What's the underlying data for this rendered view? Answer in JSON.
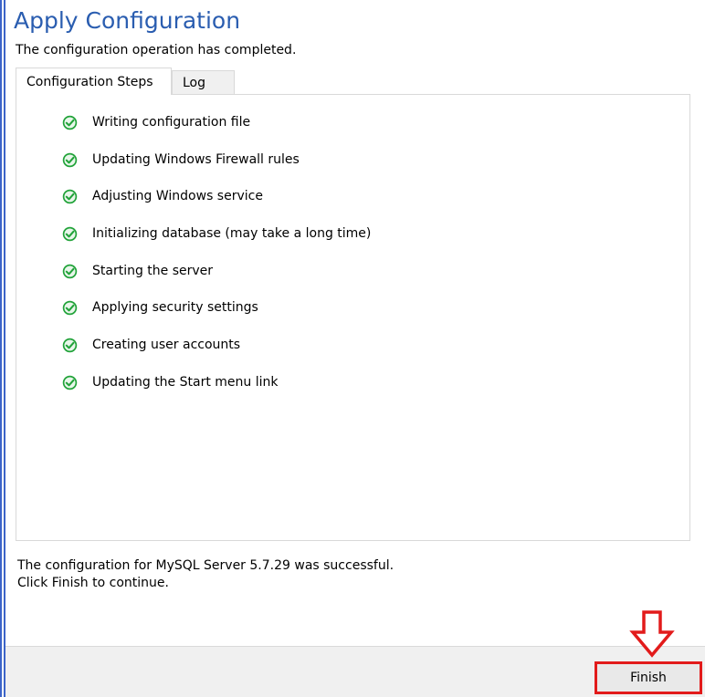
{
  "header": {
    "title": "Apply Configuration",
    "subtitle": "The configuration operation has completed."
  },
  "tabs": [
    {
      "label": "Configuration Steps",
      "active": true
    },
    {
      "label": "Log",
      "active": false
    }
  ],
  "steps": [
    {
      "label": "Writing configuration file",
      "status": "done"
    },
    {
      "label": "Updating Windows Firewall rules",
      "status": "done"
    },
    {
      "label": "Adjusting Windows service",
      "status": "done"
    },
    {
      "label": "Initializing database (may take a long time)",
      "status": "done"
    },
    {
      "label": "Starting the server",
      "status": "done"
    },
    {
      "label": "Applying security settings",
      "status": "done"
    },
    {
      "label": "Creating user accounts",
      "status": "done"
    },
    {
      "label": "Updating the Start menu link",
      "status": "done"
    }
  ],
  "result": {
    "line1": "The configuration for MySQL Server 5.7.29 was successful.",
    "line2": "Click Finish to continue."
  },
  "footer": {
    "finish_label": "Finish"
  },
  "colors": {
    "title": "#2a5db0",
    "check": "#22a33a",
    "highlight": "#e21b1b"
  },
  "icons": {
    "step_status": "check-circle-icon",
    "annotation": "down-arrow-icon"
  }
}
